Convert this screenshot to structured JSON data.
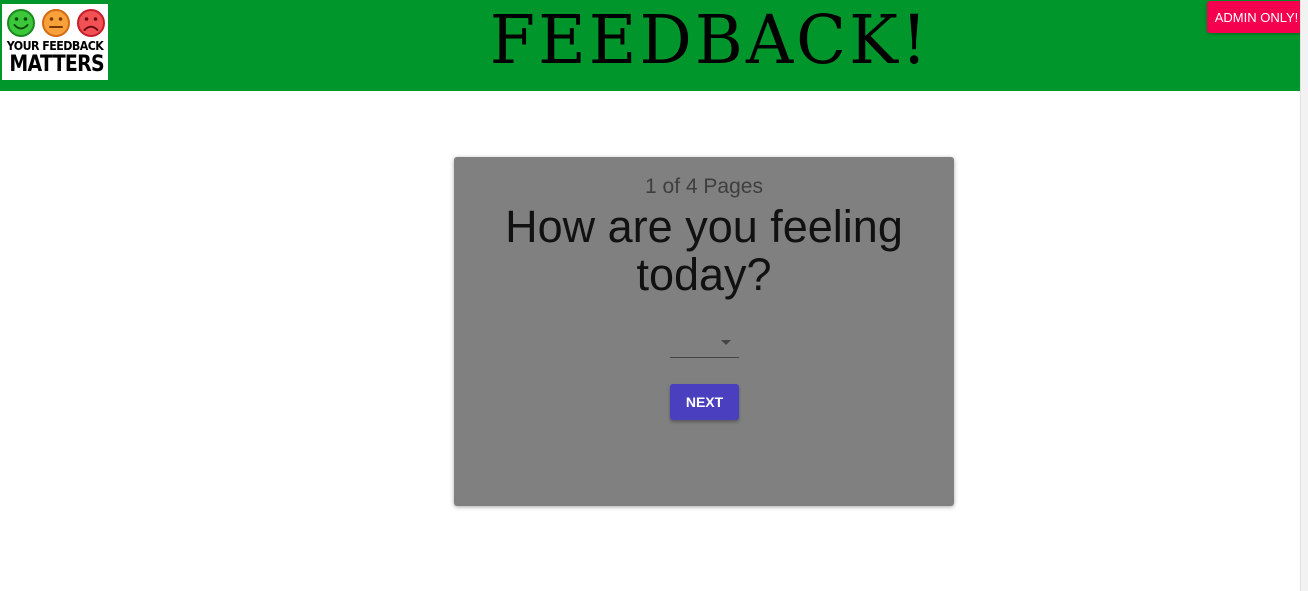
{
  "header": {
    "title": "FEEDBACK!",
    "admin_button": "ADMIN ONLY!",
    "bg_color": "#00962c"
  },
  "logo": {
    "line1": "YOUR FEEDBACK",
    "line2": "MATTERS",
    "faces": [
      "happy-face-icon",
      "neutral-face-icon",
      "sad-face-icon"
    ],
    "face_colors": [
      "#22b232",
      "#f39020",
      "#e8313b"
    ]
  },
  "card": {
    "page_indicator": "1 of 4 Pages",
    "question": "How are you feeling today?",
    "select_value": "",
    "next_button": "NEXT"
  },
  "colors": {
    "admin_button": "#f5004f",
    "next_button": "#4a3fbf",
    "card_bg": "#808080"
  }
}
